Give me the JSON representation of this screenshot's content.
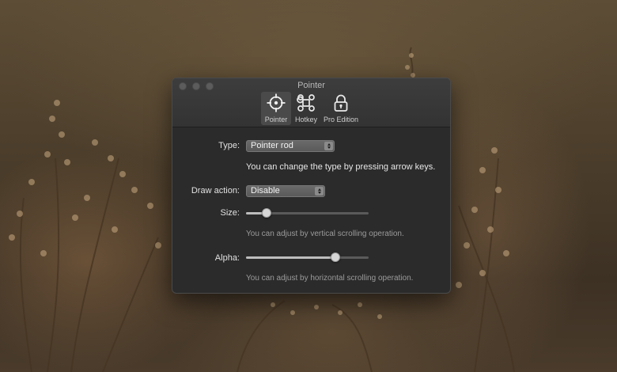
{
  "window": {
    "title": "Pointer"
  },
  "toolbar": {
    "items": [
      {
        "label": "Pointer",
        "icon": "crosshair-icon",
        "active": true
      },
      {
        "label": "Hotkey",
        "icon": "command-key-icon",
        "active": false
      },
      {
        "label": "Pro Edition",
        "icon": "lock-icon",
        "active": false
      }
    ]
  },
  "settings": {
    "type": {
      "label": "Type:",
      "value": "Pointer rod",
      "hint": "You can change the type by pressing arrow keys."
    },
    "draw_action": {
      "label": "Draw action:",
      "value": "Disable"
    },
    "size": {
      "label": "Size:",
      "level": 0.17,
      "hint": "You can adjust by vertical scrolling operation."
    },
    "alpha": {
      "label": "Alpha:",
      "level": 0.73,
      "hint": "You can adjust by horizontal scrolling operation."
    }
  },
  "colors": {
    "window_bg": "#2b2b2b",
    "titlebar_bg": "#383838",
    "popup_bg": "#626262",
    "text": "#e2e2e2"
  }
}
